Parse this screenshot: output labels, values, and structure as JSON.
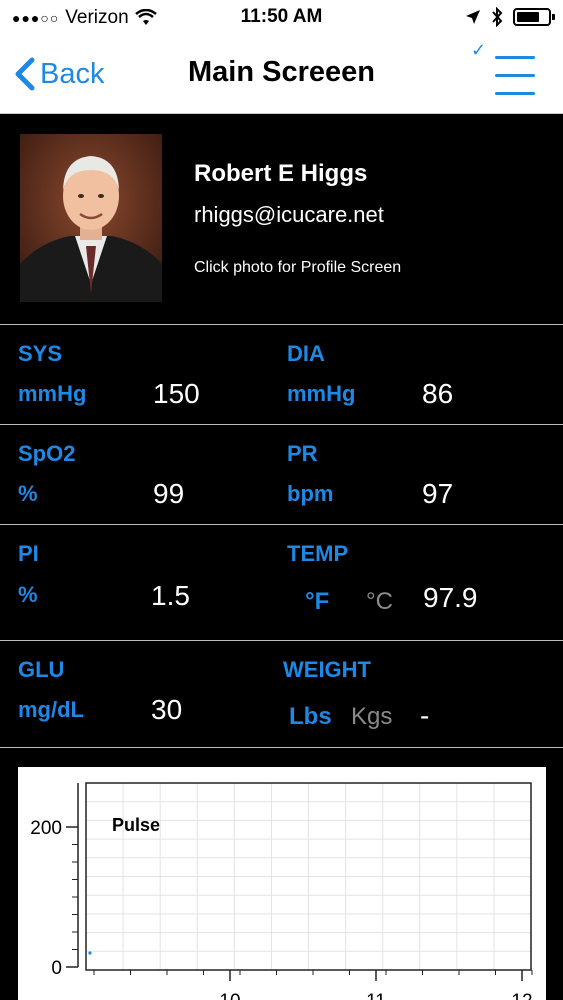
{
  "status_bar": {
    "carrier": "Verizon",
    "time": "11:50 AM",
    "signal_icon": "signal-dots-icon",
    "wifi_icon": "wifi-icon",
    "location_icon": "location-arrow-icon",
    "bluetooth_icon": "bluetooth-icon",
    "battery_icon": "battery-icon"
  },
  "nav": {
    "back_label": "Back",
    "title": "Main Screeen",
    "menu_icon": "menu-check-icon"
  },
  "profile": {
    "name": "Robert E Higgs",
    "email": "rhiggs@icucare.net",
    "hint": "Click photo for Profile Screen"
  },
  "vitals": {
    "sys": {
      "label": "SYS",
      "unit": "mmHg",
      "value": "150"
    },
    "dia": {
      "label": "DIA",
      "unit": "mmHg",
      "value": "86"
    },
    "spo2": {
      "label": "SpO2",
      "unit": "%",
      "value": "99"
    },
    "pr": {
      "label": "PR",
      "unit": "bpm",
      "value": "97"
    },
    "pi": {
      "label": "PI",
      "unit": "%",
      "value": "1.5"
    },
    "temp": {
      "label": "TEMP",
      "unit_f": "°F",
      "unit_c": "°C",
      "value": "97.9"
    },
    "glu": {
      "label": "GLU",
      "unit": "mg/dL",
      "value": "30"
    },
    "weight": {
      "label": "WEIGHT",
      "unit_lbs": "Lbs",
      "unit_kgs": "Kgs",
      "value": "-"
    }
  },
  "colors": {
    "accent": "#1e88e5",
    "inactive": "#8a8a8a",
    "background": "#000000"
  },
  "chart_data": {
    "type": "line",
    "title": "Pulse",
    "y_ticks": [
      "200",
      "0"
    ],
    "x_ticks": [
      "10",
      "11",
      "12"
    ],
    "ylim": [
      0,
      200
    ],
    "series": [
      {
        "values": [
          20
        ]
      }
    ]
  }
}
